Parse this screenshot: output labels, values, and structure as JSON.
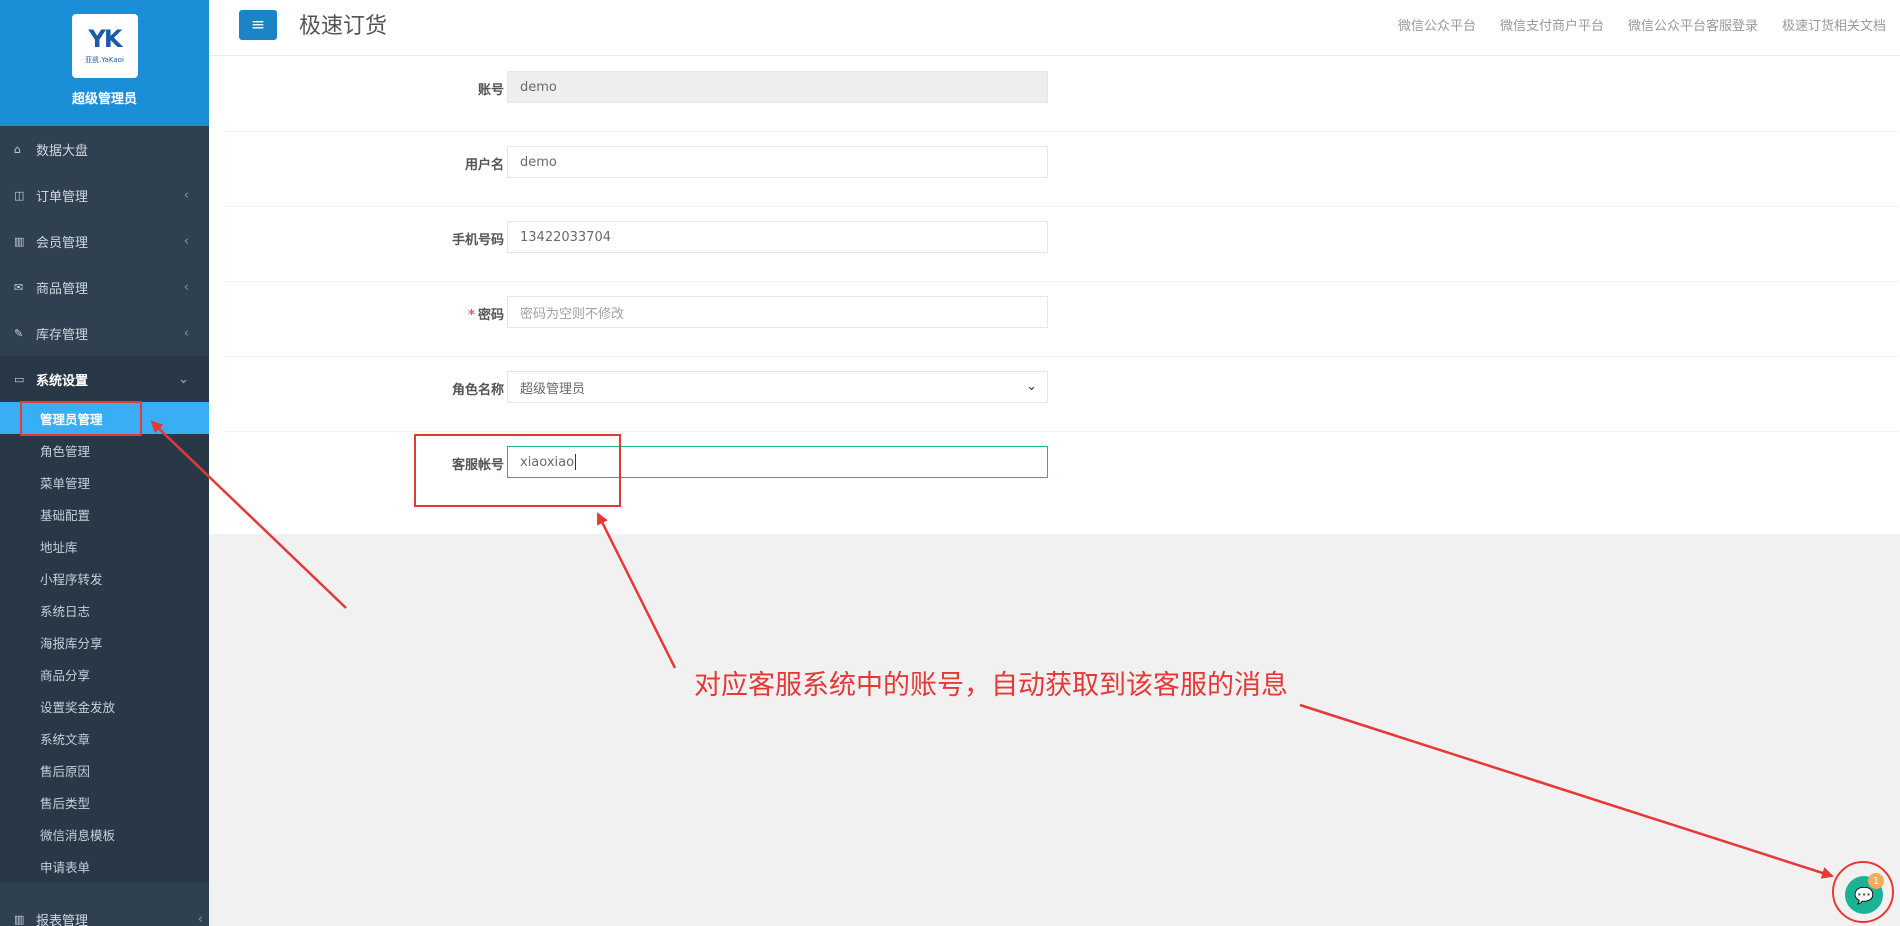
{
  "sidebar": {
    "logo_mark": "YK",
    "logo_sub": "亚凯.YaKaoi",
    "profile_name": "超级管理员",
    "items": [
      {
        "label": "数据大盘",
        "icon": "home-icon",
        "glyph": "⌂"
      },
      {
        "label": "订单管理",
        "icon": "columns-icon",
        "glyph": "◫"
      },
      {
        "label": "会员管理",
        "icon": "bar-chart-icon",
        "glyph": "▥"
      },
      {
        "label": "商品管理",
        "icon": "envelope-icon",
        "glyph": "✉"
      },
      {
        "label": "库存管理",
        "icon": "edit-icon",
        "glyph": "✎"
      },
      {
        "label": "系统设置",
        "icon": "desktop-icon",
        "glyph": "▭"
      }
    ],
    "sub_items": [
      "管理员管理",
      "角色管理",
      "菜单管理",
      "基础配置",
      "地址库",
      "小程序转发",
      "系统日志",
      "海报库分享",
      "商品分享",
      "设置奖金发放",
      "系统文章",
      "售后原因",
      "售后类型",
      "微信消息模板",
      "申请表单"
    ],
    "bottom_item": {
      "label": "报表管理",
      "icon": "bar-chart-icon",
      "glyph": "▥"
    }
  },
  "topbar": {
    "title": "极速订货",
    "links": [
      "微信公众平台",
      "微信支付商户平台",
      "微信公众平台客服登录",
      "极速订货相关文档"
    ]
  },
  "form": {
    "account_label": "账号",
    "account_value": "demo",
    "username_label": "用户名",
    "username_value": "demo",
    "phone_label": "手机号码",
    "phone_value": "13422033704",
    "password_required": "*",
    "password_label": "密码",
    "password_placeholder": "密码为空则不修改",
    "role_label": "角色名称",
    "role_value": "超级管理员",
    "cs_label": "客服帐号",
    "cs_value": "xiaoxiao"
  },
  "annotation": {
    "text": "对应客服系统中的账号，自动获取到该客服的消息",
    "color": "#e53935"
  },
  "chat": {
    "badge": "1"
  }
}
